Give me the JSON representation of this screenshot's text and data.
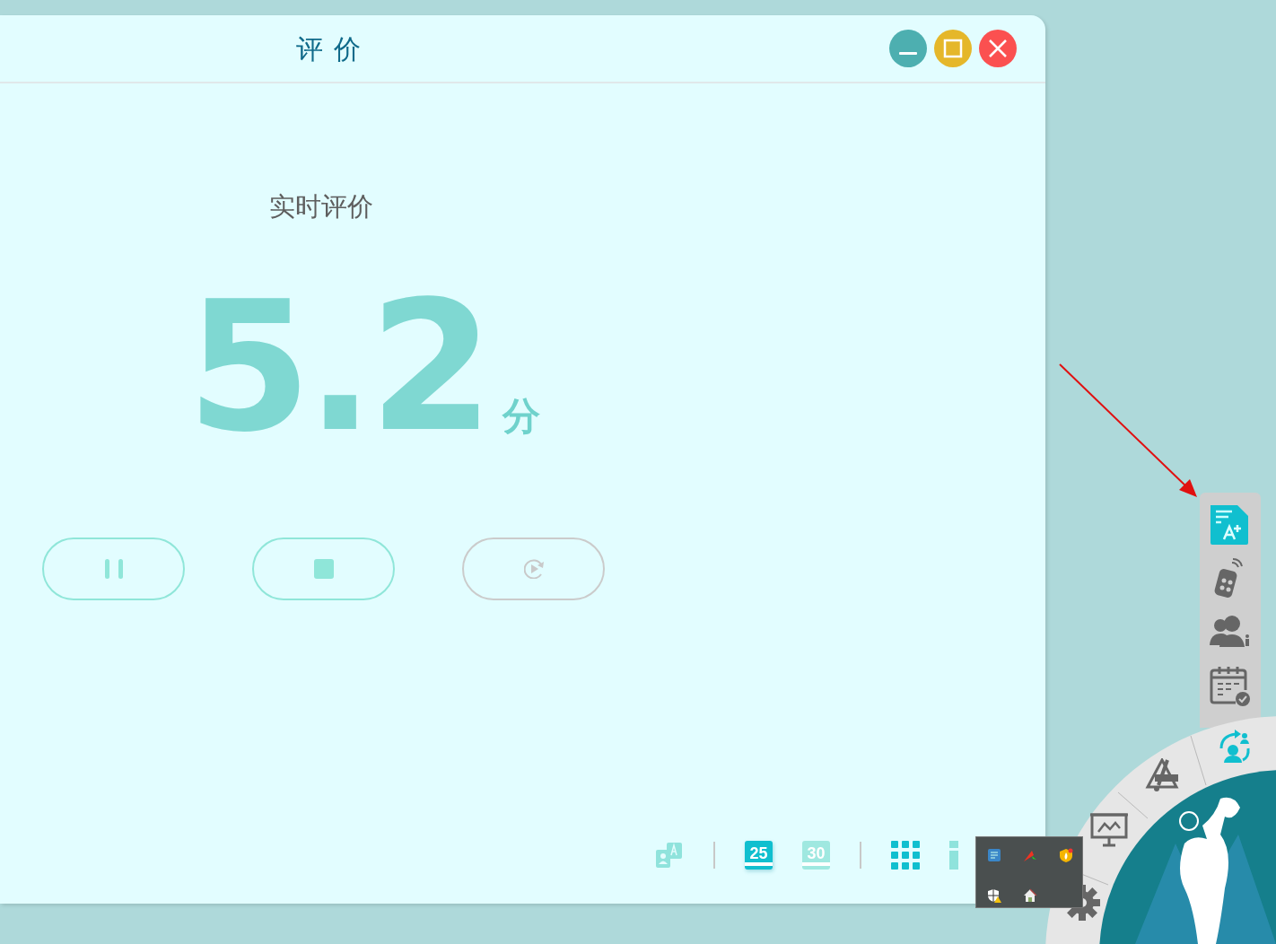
{
  "window": {
    "title": "评 价",
    "controls": [
      {
        "kind": "minimize"
      },
      {
        "kind": "maximize"
      },
      {
        "kind": "close"
      }
    ]
  },
  "evaluation": {
    "heading": "实时评价",
    "score": "5.2",
    "unit": "分"
  },
  "playback_buttons": [
    {
      "kind": "pause",
      "disabled": false
    },
    {
      "kind": "stop",
      "disabled": false
    },
    {
      "kind": "replay",
      "disabled": true
    }
  ],
  "bottom_toolbar": [
    {
      "kind": "translate",
      "selected": false
    },
    {
      "kind": "divider"
    },
    {
      "kind": "timer25",
      "label": "25",
      "selected": true
    },
    {
      "kind": "timer30",
      "label": "30",
      "selected": false
    },
    {
      "kind": "divider"
    },
    {
      "kind": "grid",
      "selected": true
    },
    {
      "kind": "info",
      "selected": false
    }
  ],
  "side_toolbar": [
    {
      "kind": "grading",
      "selected": true
    },
    {
      "kind": "remote",
      "selected": false
    },
    {
      "kind": "group",
      "selected": false
    },
    {
      "kind": "calendar",
      "selected": false
    }
  ],
  "radial_menu": [
    {
      "kind": "swap",
      "selected": true
    },
    {
      "kind": "drawing",
      "selected": false
    },
    {
      "kind": "presentation",
      "selected": false
    },
    {
      "kind": "settings",
      "selected": false
    }
  ],
  "tray_popup": [
    {
      "kind": "network"
    },
    {
      "kind": "pen"
    },
    {
      "kind": "shield-fire"
    },
    {
      "kind": "shield-warning"
    },
    {
      "kind": "home"
    }
  ]
}
